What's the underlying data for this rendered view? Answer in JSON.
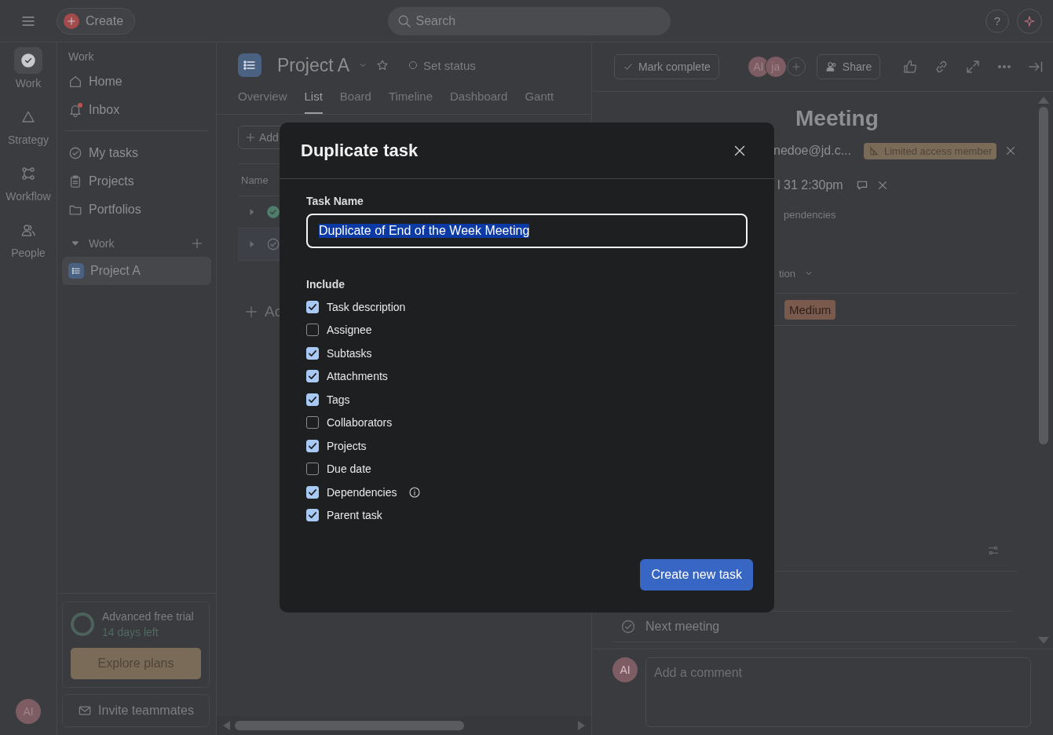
{
  "topbar": {
    "create": "Create",
    "search": {
      "placeholder": "Search"
    },
    "help": "?"
  },
  "rail": {
    "items": [
      {
        "label": "Work",
        "selected": true
      },
      {
        "label": "Strategy",
        "selected": false
      },
      {
        "label": "Workflow",
        "selected": false
      },
      {
        "label": "People",
        "selected": false
      }
    ],
    "avatar": "AI"
  },
  "sidebar": {
    "section": "Work",
    "nav": [
      {
        "label": "Home",
        "notify": false
      },
      {
        "label": "Inbox",
        "notify": true
      }
    ],
    "links": [
      {
        "label": "My tasks"
      },
      {
        "label": "Projects"
      },
      {
        "label": "Portfolios"
      }
    ],
    "group": {
      "label": "Work",
      "expanded": true,
      "projects": [
        {
          "label": "Project A",
          "selected": true
        }
      ]
    },
    "trial": {
      "title": "Advanced free trial",
      "subtitle": "14 days left",
      "button": "Explore plans"
    },
    "invite": "Invite teammates"
  },
  "project": {
    "title": "Project A",
    "status": "Set status",
    "tabs": [
      {
        "label": "Overview",
        "selected": false
      },
      {
        "label": "List",
        "selected": true
      },
      {
        "label": "Board",
        "selected": false
      },
      {
        "label": "Timeline",
        "selected": false
      },
      {
        "label": "Dashboard",
        "selected": false
      },
      {
        "label": "Gantt",
        "selected": false
      }
    ],
    "add_button": "Add",
    "column": "Name",
    "rows": [
      {
        "completed": true
      },
      {
        "completed": false
      }
    ],
    "add_section": "Ac"
  },
  "task": {
    "mark_complete": "Mark complete",
    "collaborators": [
      "AI",
      "ja"
    ],
    "share": "Share",
    "title": "Meeting",
    "assignee": "nedoe@jd.c...",
    "badge": "Limited access member",
    "due": "l 31 2:30pm",
    "dependencies": "pendencies",
    "field_toggle": "tion",
    "priority": "Medium",
    "subtasks": [
      {
        "label": "Next meeting",
        "completed": false
      }
    ],
    "comment": {
      "avatar": "AI",
      "placeholder": "Add a comment"
    }
  },
  "dialog": {
    "title": "Duplicate task",
    "name_label": "Task Name",
    "name_value": "Duplicate of End of the Week Meeting",
    "name_selected": true,
    "include_label": "Include",
    "options": [
      {
        "label": "Task description",
        "checked": true
      },
      {
        "label": "Assignee",
        "checked": false
      },
      {
        "label": "Subtasks",
        "checked": true
      },
      {
        "label": "Attachments",
        "checked": true
      },
      {
        "label": "Tags",
        "checked": true
      },
      {
        "label": "Collaborators",
        "checked": false
      },
      {
        "label": "Projects",
        "checked": true
      },
      {
        "label": "Due date",
        "checked": false
      },
      {
        "label": "Dependencies",
        "checked": true,
        "info": true
      },
      {
        "label": "Parent task",
        "checked": true
      }
    ],
    "submit": "Create new task"
  }
}
